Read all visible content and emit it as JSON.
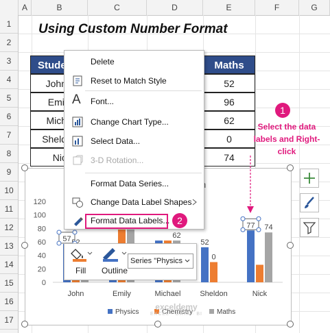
{
  "columns": [
    "A",
    "B",
    "C",
    "D",
    "E",
    "F",
    "G"
  ],
  "rows": [
    "1",
    "2",
    "3",
    "4",
    "5",
    "6",
    "7",
    "8",
    "9",
    "10",
    "11",
    "12",
    "13",
    "14",
    "15",
    "16",
    "17"
  ],
  "sheet": {
    "title": "Using Custom Number Format",
    "table_header": {
      "student": "Stude",
      "maths": "Maths"
    },
    "students": [
      "John",
      "Emil",
      "Mich",
      "Sheld",
      "Nic"
    ],
    "maths": [
      "52",
      "96",
      "62",
      "0",
      "74"
    ]
  },
  "context_menu": {
    "items": [
      {
        "label": "Delete",
        "icon": "delete-icon",
        "enabled": true
      },
      {
        "label": "Reset to Match Style",
        "icon": "reset-style-icon",
        "enabled": true
      },
      {
        "label": "Font...",
        "icon": "font-icon",
        "enabled": true
      },
      {
        "label": "Change Chart Type...",
        "icon": "chart-type-icon",
        "enabled": true
      },
      {
        "label": "Select Data...",
        "icon": "select-data-icon",
        "enabled": true
      },
      {
        "label": "3-D Rotation...",
        "icon": "rotation-icon",
        "enabled": false
      },
      {
        "label": "Format Data Series...",
        "icon": "",
        "enabled": true
      },
      {
        "label": "Change Data Label Shapes",
        "icon": "shapes-icon",
        "enabled": true
      },
      {
        "label": "Format Data Labels...",
        "icon": "format-labels-icon",
        "enabled": true
      }
    ]
  },
  "annotations": {
    "step1_number": "1",
    "step1_text": "Select the data labels and Right-click",
    "step2_number": "2",
    "accent_color": "#e0197d"
  },
  "mini_toolbar": {
    "fill_label": "Fill",
    "outline_label": "Outline",
    "series_select": "Series \"Physics"
  },
  "chart_partial_title": "n",
  "chart_data": {
    "type": "bar",
    "categories": [
      "John",
      "Emily",
      "Michael",
      "Sheldon",
      "Nick"
    ],
    "series": [
      {
        "name": "Physics",
        "color": "#4472c4",
        "values": [
          57,
          52,
          62,
          52,
          77
        ]
      },
      {
        "name": "Chemistry",
        "color": "#ed7d31",
        "values": [
          52,
          96,
          62,
          30,
          26
        ]
      },
      {
        "name": "Maths",
        "color": "#a5a5a5",
        "values": [
          52,
          96,
          62,
          0,
          74
        ]
      }
    ],
    "y_ticks": [
      "0",
      "20",
      "40",
      "60",
      "80",
      "100",
      "120"
    ],
    "ylim": [
      0,
      120
    ],
    "data_labels": {
      "John": {
        "Physics": "57",
        "Chemistry": "52"
      },
      "Michael": {
        "Maths": "62"
      },
      "Sheldon": {
        "Physics": "52",
        "Chemistry": "0"
      },
      "Nick": {
        "Physics": "77",
        "Maths": "74"
      }
    },
    "legend_position": "bottom"
  },
  "watermark": {
    "name": "exceldemy",
    "tagline": "EXCEL · DATA · BI"
  }
}
